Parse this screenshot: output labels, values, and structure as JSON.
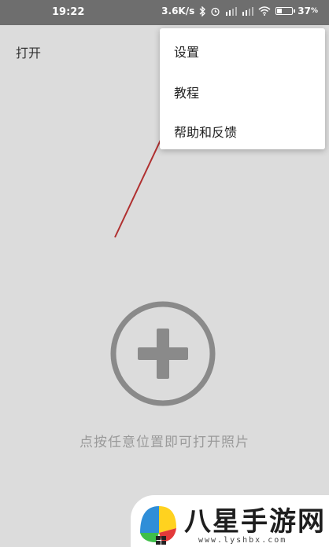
{
  "status_bar": {
    "time": "19:22",
    "net_speed": "3.6K/s",
    "battery_pct": "37",
    "battery_unit": "%",
    "battery_level": 0.37,
    "icons": [
      "bluetooth-icon",
      "alarm-icon",
      "hd-signal-icon-1",
      "signal-bars-icon-1",
      "hd-signal-icon-2",
      "signal-bars-icon-2",
      "wifi-icon",
      "battery-icon"
    ]
  },
  "app_bar": {
    "open_label": "打开"
  },
  "popup_menu": {
    "items": [
      {
        "label": "设置"
      },
      {
        "label": "教程"
      },
      {
        "label": "帮助和反馈"
      }
    ]
  },
  "main": {
    "add_icon": "add-circle-icon",
    "hint": "点按任意位置即可打开照片"
  },
  "watermark": {
    "title": "八星手游网",
    "url": "www.lyshbx.com"
  },
  "colors": {
    "background": "#dcdcdc",
    "status_bar": "#6e6e6e",
    "annotation_arrow": "#b03030",
    "icon_gray": "#8a8a8a"
  }
}
